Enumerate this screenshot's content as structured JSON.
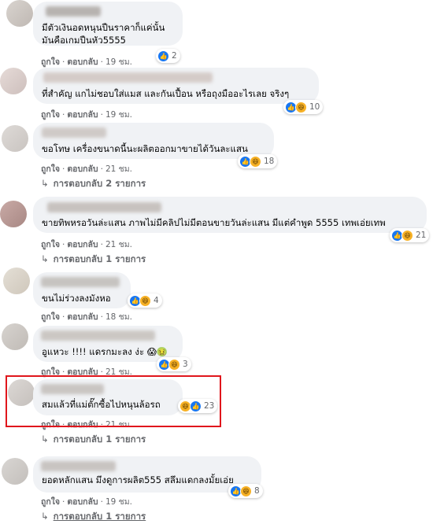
{
  "comments": [
    {
      "text_lines": [
        "มีตัวเงินอดหนุนปืนราคาก็แค่นั้น",
        "มันคือเกมปืนหัว5555"
      ],
      "like": "ถูกใจ",
      "reply": "ตอบกลับ",
      "time": "19 ชม.",
      "reactions": [
        "like"
      ],
      "count": "2"
    },
    {
      "text_lines": [
        "ที่สำคัญ แกไม่ชอบใส่แมส และกันเปื้อน หรือถุงมืออะไรเลย จริงๆ"
      ],
      "like": "ถูกใจ",
      "reply": "ตอบกลับ",
      "time": "19 ชม.",
      "reactions": [
        "like",
        "haha"
      ],
      "count": "10"
    },
    {
      "text_lines": [
        "ขอโทษ เครื่องขนาดนี้นะผลิตออกมาขายได้วันละแสน"
      ],
      "like": "ถูกใจ",
      "reply": "ตอบกลับ",
      "time": "21 ชม.",
      "reactions": [
        "like",
        "haha"
      ],
      "count": "18",
      "replies": "การตอบกลับ 2 รายการ"
    },
    {
      "text_lines": [
        "ขายทิพหรอวันล่ะแสน ภาพไม่มีคลิปไม่มีตอนขายวันล่ะแสน มีแต่คำพูด 5555 เทพเอ่ยเทพ"
      ],
      "like": "ถูกใจ",
      "reply": "ตอบกลับ",
      "time": "21 ชม.",
      "reactions": [
        "like",
        "haha"
      ],
      "count": "21",
      "replies": "การตอบกลับ 1 รายการ"
    },
    {
      "text_lines": [
        "ขนไม่ร่วงลงมังหอ"
      ],
      "like": "ถูกใจ",
      "reply": "ตอบกลับ",
      "time": "18 ชม.",
      "reactions": [
        "like",
        "haha"
      ],
      "count": "4"
    },
    {
      "text_lines": [
        "อูแหวะ !!!! แดรกมะลง ง่ะ 😱🤢"
      ],
      "like": "ถูกใจ",
      "reply": "ตอบกลับ",
      "time": "21 ชม.",
      "reactions": [
        "like",
        "haha"
      ],
      "count": "3"
    },
    {
      "text_lines": [
        "สมแล้วที่แม่ตั๊กซื้อไปหนุนล้อรถ"
      ],
      "like": "ถูกใจ",
      "reply": "ตอบกลับ",
      "time": "21 ชม.",
      "reactions": [
        "haha",
        "like"
      ],
      "count": "23",
      "replies": "การตอบกลับ 1 รายการ"
    },
    {
      "text_lines": [
        "ยอดหลักแสน มึงดูการผลิต555 สลึมแดกลงมั้ยเอ่ย"
      ],
      "like": "ถูกใจ",
      "reply": "ตอบกลับ",
      "time": "19 ชม.",
      "reactions": [
        "like",
        "haha"
      ],
      "count": "8",
      "replies": "การตอบกลับ 1 รายการ"
    }
  ],
  "colors": {
    "bubble": "#f0f2f5",
    "meta": "#65676b",
    "like": "#1877f2",
    "highlight": "#e0161c"
  },
  "icons": {
    "like": "thumbs-up-icon",
    "haha": "laughing-face-icon",
    "reply_arrow": "reply-arrow-icon"
  }
}
